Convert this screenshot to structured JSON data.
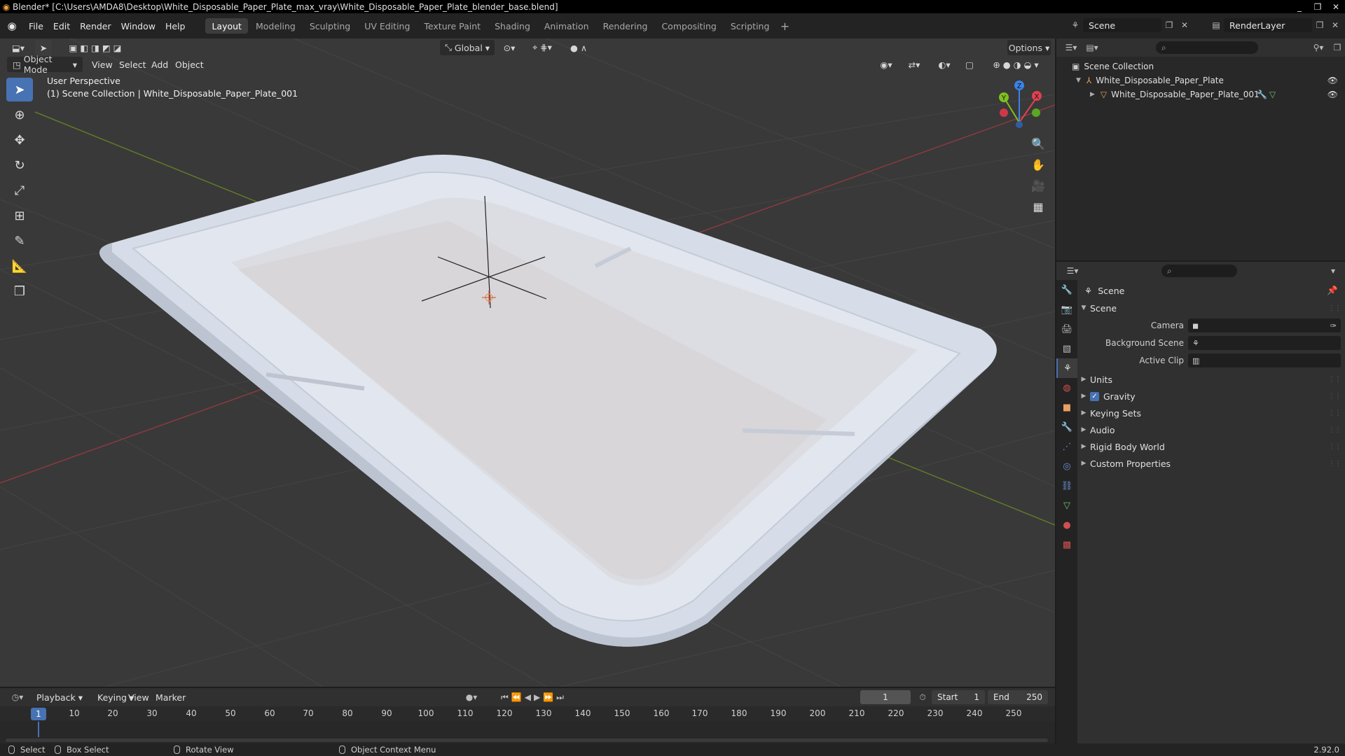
{
  "window": {
    "title": "Blender* [C:\\Users\\AMDA8\\Desktop\\White_Disposable_Paper_Plate_max_vray\\White_Disposable_Paper_Plate_blender_base.blend]",
    "minimize": "_",
    "maximize": "❐",
    "close": "✕"
  },
  "menu": [
    "File",
    "Edit",
    "Render",
    "Window",
    "Help"
  ],
  "workspaces": [
    {
      "label": "Layout",
      "active": true
    },
    {
      "label": "Modeling"
    },
    {
      "label": "Sculpting"
    },
    {
      "label": "UV Editing"
    },
    {
      "label": "Texture Paint"
    },
    {
      "label": "Shading"
    },
    {
      "label": "Animation"
    },
    {
      "label": "Rendering"
    },
    {
      "label": "Compositing"
    },
    {
      "label": "Scripting"
    }
  ],
  "workspace_add": "+",
  "scene_selector": {
    "value": "Scene"
  },
  "renderlayer_selector": {
    "value": "RenderLayer"
  },
  "viewport": {
    "transform_orientation": "Global",
    "options_label": "Options",
    "mode": "Object Mode",
    "menus": [
      "View",
      "Select",
      "Add",
      "Object"
    ],
    "overlay_line1": "User Perspective",
    "overlay_line2": "(1) Scene Collection | White_Disposable_Paper_Plate_001",
    "gizmo": {
      "x": "X",
      "y": "Y",
      "z": "Z"
    }
  },
  "outliner": {
    "root": "Scene Collection",
    "collection": "White_Disposable_Paper_Plate",
    "object": "White_Disposable_Paper_Plate_001"
  },
  "properties": {
    "context": "Scene",
    "panel_title": "Scene",
    "fields": [
      {
        "label": "Camera",
        "value": ""
      },
      {
        "label": "Background Scene",
        "value": ""
      },
      {
        "label": "Active Clip",
        "value": ""
      }
    ],
    "subpanels": [
      {
        "label": "Units",
        "checkbox": false
      },
      {
        "label": "Gravity",
        "checkbox": true
      },
      {
        "label": "Keying Sets",
        "checkbox": false
      },
      {
        "label": "Audio",
        "checkbox": false
      },
      {
        "label": "Rigid Body World",
        "checkbox": false
      },
      {
        "label": "Custom Properties",
        "checkbox": false
      }
    ]
  },
  "timeline": {
    "menus": [
      "Playback",
      "Keying",
      "View",
      "Marker"
    ],
    "current_frame": "1",
    "start_label": "Start",
    "start_value": "1",
    "end_label": "End",
    "end_value": "250",
    "ruler": [
      "10",
      "20",
      "30",
      "40",
      "50",
      "60",
      "70",
      "80",
      "90",
      "100",
      "110",
      "120",
      "130",
      "140",
      "150",
      "160",
      "170",
      "180",
      "190",
      "200",
      "210",
      "220",
      "230",
      "240",
      "250"
    ],
    "ruler_current": "1"
  },
  "statusbar": {
    "select": "Select",
    "box_select": "Box Select",
    "rotate_view": "Rotate View",
    "context_menu": "Object Context Menu",
    "version": "2.92.0"
  },
  "colors": {
    "accent": "#4772b3",
    "x_axis": "#e04050",
    "y_axis": "#80c020",
    "z_axis": "#3a82e6"
  }
}
